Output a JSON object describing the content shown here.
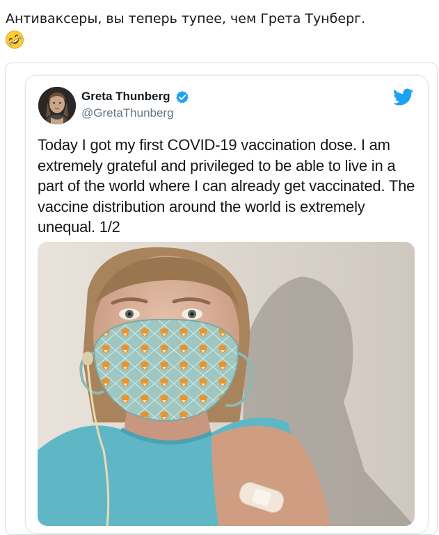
{
  "post": {
    "text": "Антиваксеры, вы теперь тупее, чем Грета Тунберг.",
    "emoji": "rolling-on-the-floor-laughing-emoji"
  },
  "tweet": {
    "author": {
      "display_name": "Greta Thunberg",
      "handle": "@GretaThunberg",
      "verified": true
    },
    "body": "Today I got my first COVID-19 vaccination dose. I am extremely grateful and privileged to be able to live in a part of the world where I can already get vaccinated. The vaccine distribution around the world is extremely unequal. 1/2",
    "brand_icon": "twitter-bird-icon",
    "photo": "selfie-with-fox-print-mask-and-bandage"
  },
  "colors": {
    "verified_blue": "#1da1f2",
    "twitter_blue": "#1da1f2",
    "name_text": "#14171a",
    "handle_text": "#657786"
  }
}
